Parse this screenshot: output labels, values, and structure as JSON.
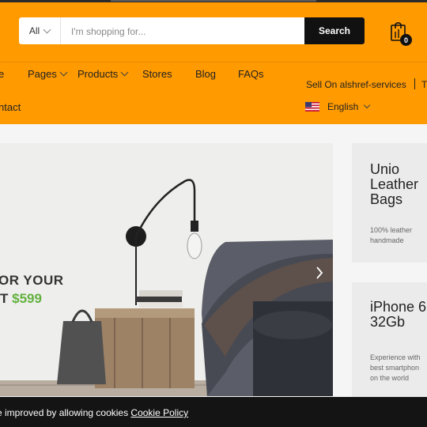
{
  "search": {
    "category_label": "All",
    "placeholder": "I'm shopping for...",
    "button_label": "Search"
  },
  "cart": {
    "count": "0",
    "icon": "cart-icon"
  },
  "nav": {
    "items": [
      {
        "label": "e",
        "has_dropdown": false
      },
      {
        "label": "Pages",
        "has_dropdown": true
      },
      {
        "label": "Products",
        "has_dropdown": true
      },
      {
        "label": "Stores",
        "has_dropdown": false
      },
      {
        "label": "Blog",
        "has_dropdown": false
      },
      {
        "label": "FAQs",
        "has_dropdown": false
      }
    ],
    "contact": "ntact"
  },
  "topbar": {
    "sell_link": "Sell On alshref-services",
    "partial_link": "T",
    "language": "English",
    "language_flag": "us-flag-icon"
  },
  "banner": {
    "line1": "OR YOUR",
    "line2_prefix": "T ",
    "price": "$599",
    "next_icon": "chevron-right-icon"
  },
  "cards": [
    {
      "title": "Unio\nLeather\nBags",
      "subtitle": "100% leather\nhandmade"
    },
    {
      "title": "iPhone 6\n32Gb",
      "subtitle": "Experience with\nbest smartphon\non the world"
    }
  ],
  "cookie": {
    "text": "e improved by allowing cookies ",
    "link": "Cookie Policy"
  },
  "colors": {
    "header": "#ff9a00",
    "price_green": "#62b13d",
    "search_button": "#111111",
    "cookie_bar": "#141414"
  }
}
